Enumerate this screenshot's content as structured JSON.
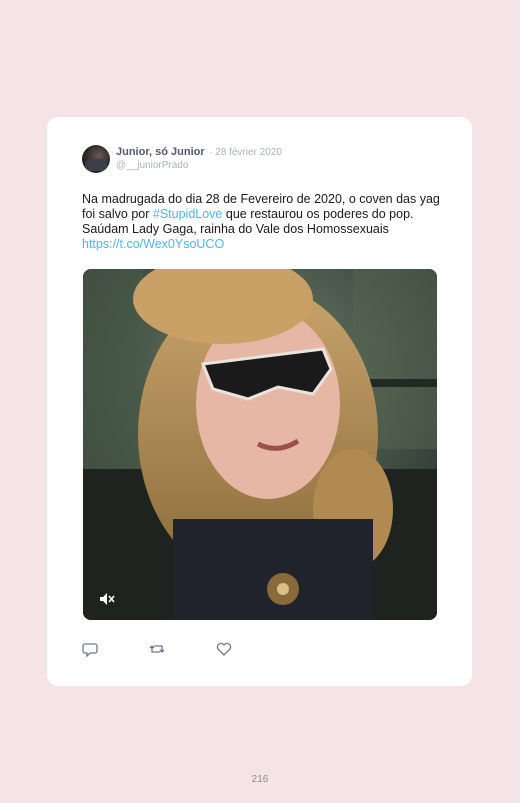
{
  "tweet": {
    "display_name": "Junior, só Junior",
    "date": "· 28 février 2020",
    "handle": "@__juniorPrado",
    "text_part1": "Na madrugada do dia 28 de Fevereiro de 2020, o coven das yag foi salvo por ",
    "hashtag": "#StupidLove",
    "text_part2": " que restaurou os poderes do pop. Saúdam Lady Gaga, rainha do Vale dos Homossexuais ",
    "url": "https://t.co/Wex0YsoUCO"
  },
  "icons": {
    "media_sound": "mute-icon",
    "reply": "reply-icon",
    "retweet": "retweet-icon",
    "like": "heart-icon"
  },
  "colors": {
    "background": "#f4e4e8",
    "card": "#ffffff",
    "link": "#4fb7e8",
    "muted_text": "#aab2bc"
  },
  "page": {
    "number": "216"
  }
}
